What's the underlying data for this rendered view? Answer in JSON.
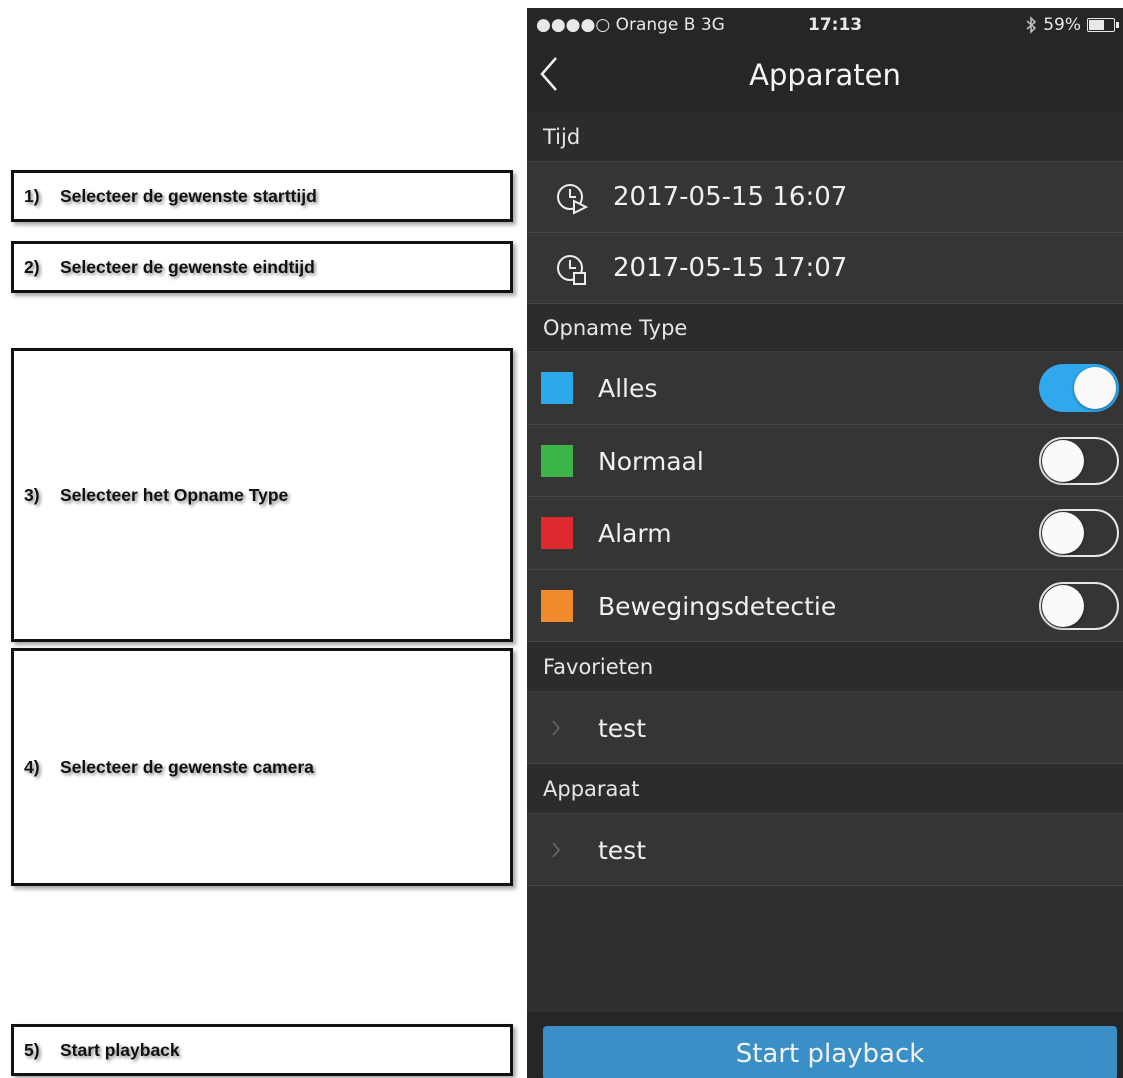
{
  "annotations": [
    {
      "num": "1)",
      "text": "Selecteer de gewenste starttijd"
    },
    {
      "num": "2)",
      "text": "Selecteer de gewenste eindtijd"
    },
    {
      "num": "3)",
      "text": "Selecteer het Opname Type"
    },
    {
      "num": "4)",
      "text": "Selecteer de gewenste camera"
    },
    {
      "num": "5)",
      "text": "Start playback"
    }
  ],
  "status_bar": {
    "carrier": "●●●●○ Orange B  3G",
    "time": "17:13",
    "battery": "59%",
    "battery_level": 0.59,
    "bluetooth_icon": "bluetooth-icon"
  },
  "nav": {
    "back_icon": "chevron-left-icon",
    "title": "Apparaten"
  },
  "time_section": {
    "header": "Tijd",
    "start": "2017-05-15 16:07",
    "end": "2017-05-15 17:07",
    "start_icon": "clock-play-icon",
    "end_icon": "clock-stop-icon"
  },
  "record_type": {
    "header": "Opname Type",
    "items": [
      {
        "label": "Alles",
        "color": "#2aa8e8",
        "on": true
      },
      {
        "label": "Normaal",
        "color": "#3cb44a",
        "on": false
      },
      {
        "label": "Alarm",
        "color": "#dc2a2e",
        "on": false
      },
      {
        "label": "Bewegingsdetectie",
        "color": "#f08a2c",
        "on": false
      }
    ]
  },
  "favorites": {
    "header": "Favorieten",
    "items": [
      {
        "label": "test"
      }
    ]
  },
  "devices": {
    "header": "Apparaat",
    "items": [
      {
        "label": "test"
      }
    ]
  },
  "footer": {
    "button": "Start playback",
    "button_color": "#3a8fc6"
  }
}
